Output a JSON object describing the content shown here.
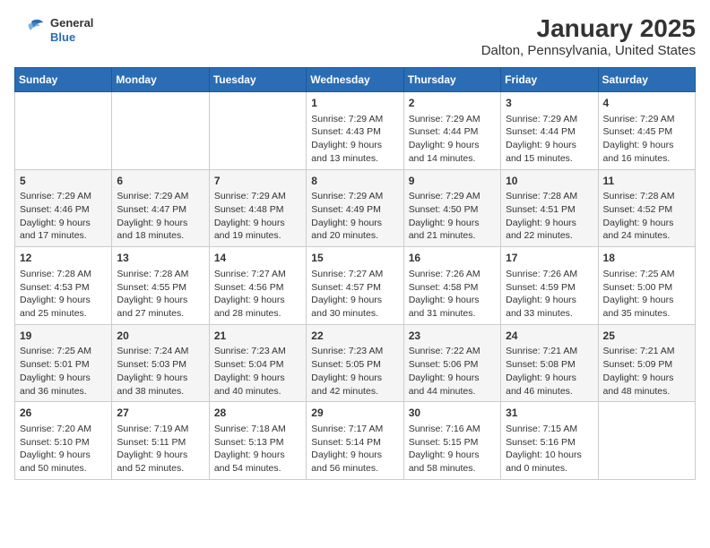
{
  "logo": {
    "general": "General",
    "blue": "Blue"
  },
  "title": "January 2025",
  "subtitle": "Dalton, Pennsylvania, United States",
  "days_of_week": [
    "Sunday",
    "Monday",
    "Tuesday",
    "Wednesday",
    "Thursday",
    "Friday",
    "Saturday"
  ],
  "weeks": [
    [
      {
        "day": "",
        "info": ""
      },
      {
        "day": "",
        "info": ""
      },
      {
        "day": "",
        "info": ""
      },
      {
        "day": "1",
        "info": "Sunrise: 7:29 AM\nSunset: 4:43 PM\nDaylight: 9 hours\nand 13 minutes."
      },
      {
        "day": "2",
        "info": "Sunrise: 7:29 AM\nSunset: 4:44 PM\nDaylight: 9 hours\nand 14 minutes."
      },
      {
        "day": "3",
        "info": "Sunrise: 7:29 AM\nSunset: 4:44 PM\nDaylight: 9 hours\nand 15 minutes."
      },
      {
        "day": "4",
        "info": "Sunrise: 7:29 AM\nSunset: 4:45 PM\nDaylight: 9 hours\nand 16 minutes."
      }
    ],
    [
      {
        "day": "5",
        "info": "Sunrise: 7:29 AM\nSunset: 4:46 PM\nDaylight: 9 hours\nand 17 minutes."
      },
      {
        "day": "6",
        "info": "Sunrise: 7:29 AM\nSunset: 4:47 PM\nDaylight: 9 hours\nand 18 minutes."
      },
      {
        "day": "7",
        "info": "Sunrise: 7:29 AM\nSunset: 4:48 PM\nDaylight: 9 hours\nand 19 minutes."
      },
      {
        "day": "8",
        "info": "Sunrise: 7:29 AM\nSunset: 4:49 PM\nDaylight: 9 hours\nand 20 minutes."
      },
      {
        "day": "9",
        "info": "Sunrise: 7:29 AM\nSunset: 4:50 PM\nDaylight: 9 hours\nand 21 minutes."
      },
      {
        "day": "10",
        "info": "Sunrise: 7:28 AM\nSunset: 4:51 PM\nDaylight: 9 hours\nand 22 minutes."
      },
      {
        "day": "11",
        "info": "Sunrise: 7:28 AM\nSunset: 4:52 PM\nDaylight: 9 hours\nand 24 minutes."
      }
    ],
    [
      {
        "day": "12",
        "info": "Sunrise: 7:28 AM\nSunset: 4:53 PM\nDaylight: 9 hours\nand 25 minutes."
      },
      {
        "day": "13",
        "info": "Sunrise: 7:28 AM\nSunset: 4:55 PM\nDaylight: 9 hours\nand 27 minutes."
      },
      {
        "day": "14",
        "info": "Sunrise: 7:27 AM\nSunset: 4:56 PM\nDaylight: 9 hours\nand 28 minutes."
      },
      {
        "day": "15",
        "info": "Sunrise: 7:27 AM\nSunset: 4:57 PM\nDaylight: 9 hours\nand 30 minutes."
      },
      {
        "day": "16",
        "info": "Sunrise: 7:26 AM\nSunset: 4:58 PM\nDaylight: 9 hours\nand 31 minutes."
      },
      {
        "day": "17",
        "info": "Sunrise: 7:26 AM\nSunset: 4:59 PM\nDaylight: 9 hours\nand 33 minutes."
      },
      {
        "day": "18",
        "info": "Sunrise: 7:25 AM\nSunset: 5:00 PM\nDaylight: 9 hours\nand 35 minutes."
      }
    ],
    [
      {
        "day": "19",
        "info": "Sunrise: 7:25 AM\nSunset: 5:01 PM\nDaylight: 9 hours\nand 36 minutes."
      },
      {
        "day": "20",
        "info": "Sunrise: 7:24 AM\nSunset: 5:03 PM\nDaylight: 9 hours\nand 38 minutes."
      },
      {
        "day": "21",
        "info": "Sunrise: 7:23 AM\nSunset: 5:04 PM\nDaylight: 9 hours\nand 40 minutes."
      },
      {
        "day": "22",
        "info": "Sunrise: 7:23 AM\nSunset: 5:05 PM\nDaylight: 9 hours\nand 42 minutes."
      },
      {
        "day": "23",
        "info": "Sunrise: 7:22 AM\nSunset: 5:06 PM\nDaylight: 9 hours\nand 44 minutes."
      },
      {
        "day": "24",
        "info": "Sunrise: 7:21 AM\nSunset: 5:08 PM\nDaylight: 9 hours\nand 46 minutes."
      },
      {
        "day": "25",
        "info": "Sunrise: 7:21 AM\nSunset: 5:09 PM\nDaylight: 9 hours\nand 48 minutes."
      }
    ],
    [
      {
        "day": "26",
        "info": "Sunrise: 7:20 AM\nSunset: 5:10 PM\nDaylight: 9 hours\nand 50 minutes."
      },
      {
        "day": "27",
        "info": "Sunrise: 7:19 AM\nSunset: 5:11 PM\nDaylight: 9 hours\nand 52 minutes."
      },
      {
        "day": "28",
        "info": "Sunrise: 7:18 AM\nSunset: 5:13 PM\nDaylight: 9 hours\nand 54 minutes."
      },
      {
        "day": "29",
        "info": "Sunrise: 7:17 AM\nSunset: 5:14 PM\nDaylight: 9 hours\nand 56 minutes."
      },
      {
        "day": "30",
        "info": "Sunrise: 7:16 AM\nSunset: 5:15 PM\nDaylight: 9 hours\nand 58 minutes."
      },
      {
        "day": "31",
        "info": "Sunrise: 7:15 AM\nSunset: 5:16 PM\nDaylight: 10 hours\nand 0 minutes."
      },
      {
        "day": "",
        "info": ""
      }
    ]
  ]
}
